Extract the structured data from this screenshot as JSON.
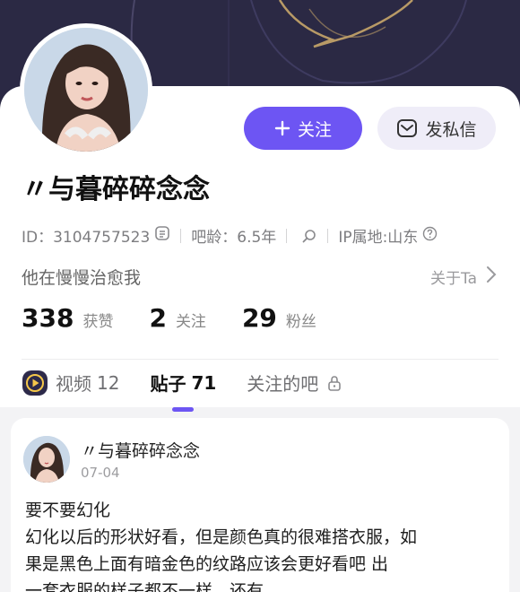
{
  "profile": {
    "username": "〃与暮碎碎念念",
    "follow_label": "关注",
    "message_label": "发私信",
    "meta": {
      "id_text": "ID：3104757523",
      "bar_age_text": "吧龄：6.5年",
      "ip_text": "IP属地:山东"
    },
    "bio": "他在慢慢治愈我",
    "about_label": "关于Ta",
    "stats": [
      {
        "value": "338",
        "label": "获赞"
      },
      {
        "value": "2",
        "label": "关注"
      },
      {
        "value": "29",
        "label": "粉丝"
      }
    ]
  },
  "tabs": [
    {
      "label": "视频",
      "count": "12"
    },
    {
      "label": "贴子",
      "count": "71"
    },
    {
      "label": "关注的吧",
      "count": ""
    }
  ],
  "post": {
    "author": "〃与暮碎碎念念",
    "date": "07-04",
    "lines": [
      "要不要幻化",
      "幻化以后的形状好看，但是颜色真的很难搭衣服，如",
      "果是黑色上面有暗金色的纹路应该会更好看吧   出",
      "一套衣服的样子都不一样，还有"
    ]
  },
  "colors": {
    "accent": "#6d55f3",
    "banner": "#2b2944",
    "banner_line": "#b89a66"
  },
  "icons": [
    "plus-icon",
    "mail-icon",
    "copy-icon",
    "search-icon",
    "help-icon",
    "chevron-right-icon",
    "video-play-icon",
    "lock-icon"
  ]
}
